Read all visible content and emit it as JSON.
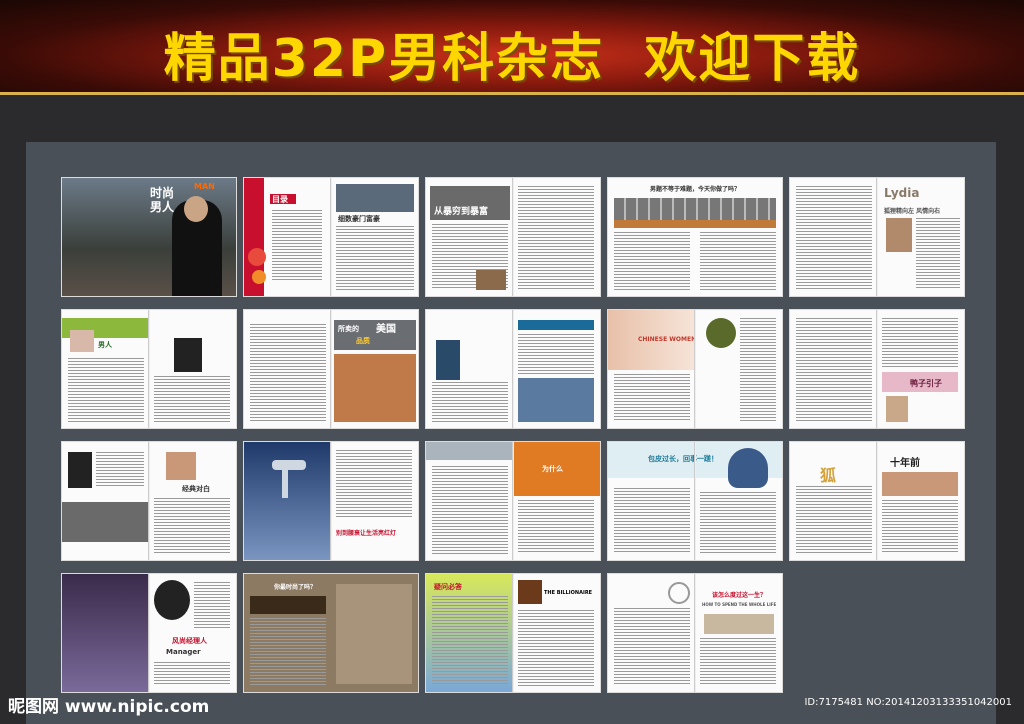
{
  "banner": {
    "title": "精品32P男科杂志  欢迎下载"
  },
  "pages": {
    "p1": {
      "t1": "时尚",
      "t2": "男人",
      "t3": "MAN"
    },
    "p2": {
      "t1": "目录",
      "t2": "细数豪门富豪"
    },
    "p3": {
      "t1": "从暴穷到暴富"
    },
    "p4": {
      "t1": "男题不等于难题，今天你做了吗？"
    },
    "p5": {
      "t1": "Lydia",
      "t2": "狐狸精向左 风情向右"
    },
    "p6": {
      "t1": "男人"
    },
    "p7": {
      "t1": "所卖的",
      "t2": "美国",
      "t3": "品质"
    },
    "p9": {
      "t1": "CHINESE WOMEN"
    },
    "p10": {
      "t1": "鸭子引子"
    },
    "p11": {
      "t1": "经典对白"
    },
    "p12": {
      "t1": "别到腰衰让生活亮红灯"
    },
    "p13": {
      "t1": "为什么"
    },
    "p14": {
      "t1": "包皮过长，回事一蹉！"
    },
    "p15": {
      "t1": "十年前",
      "t2": "狐"
    },
    "p16": {
      "t1": "风尚经理人",
      "t2": "Manager"
    },
    "p17": {
      "t1": "你最时尚了吗？"
    },
    "p18": {
      "t1": "疑问必答",
      "t2": "THE BILLIONAIRE"
    },
    "p19": {
      "t1": "该怎么度过这一生？",
      "t2": "HOW TO SPEND THE WHOLE LIFE"
    }
  },
  "footer": {
    "logo": "昵图网 www.nipic.com",
    "id": "ID:7175481 NO:20141203133351042001"
  },
  "colors": {
    "gold": "#ffd700",
    "board": "#4a5057",
    "bg": "#2b2b2d"
  }
}
